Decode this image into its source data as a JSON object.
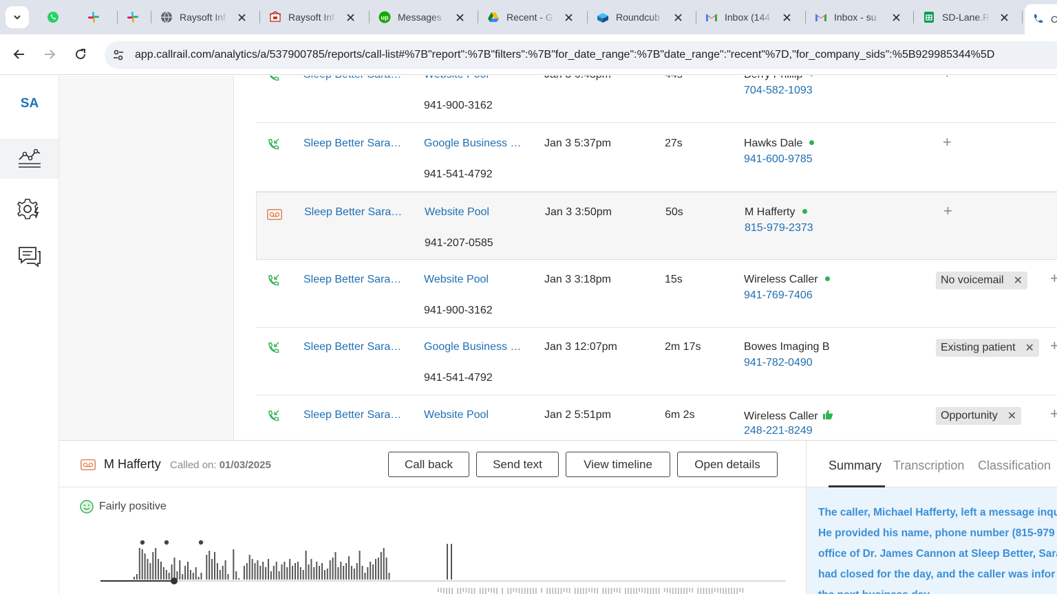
{
  "browser": {
    "tabs": [
      {
        "label": "",
        "icon": "whatsapp-icon"
      },
      {
        "label": "",
        "icon": "slack-icon"
      },
      {
        "label": "",
        "icon": "slack-icon"
      },
      {
        "label": "Raysoft Inf",
        "icon": "globe-icon"
      },
      {
        "label": "Raysoft Inf",
        "icon": "raysoft-icon"
      },
      {
        "label": "Messages",
        "icon": "upwork-icon"
      },
      {
        "label": "Recent - G",
        "icon": "google-drive-icon"
      },
      {
        "label": "Roundcub",
        "icon": "roundcube-icon"
      },
      {
        "label": "Inbox (144",
        "icon": "gmail-icon"
      },
      {
        "label": "Inbox - su",
        "icon": "gmail-icon"
      },
      {
        "label": "SD-Lane.R",
        "icon": "google-sheets-icon"
      },
      {
        "label": "C",
        "icon": "callrail-icon"
      }
    ],
    "url": "app.callrail.com/analytics/a/537900785/reports/call-list#%7B\"report\":%7B\"filters\":%7B\"for_date_range\":%7B\"date_range\":\"recent\"%7D,\"for_company_sids\":%5B929985344%5D"
  },
  "rail": {
    "logo": "SA"
  },
  "calls": [
    {
      "company": "Sleep Better Sara…",
      "source": "Website Pool",
      "tracking": "941-900-3162",
      "datetime": "Jan 3 6:43pm",
      "duration": "44s",
      "caller": "Berry Phillip",
      "caller_phone": "704-582-1093",
      "status": "dot",
      "tag": "",
      "type": "inbound"
    },
    {
      "company": "Sleep Better Sara…",
      "source": "Google Business …",
      "tracking": "941-541-4792",
      "datetime": "Jan 3 5:37pm",
      "duration": "27s",
      "caller": "Hawks Dale",
      "caller_phone": "941-600-9785",
      "status": "dot",
      "tag": "",
      "type": "inbound"
    },
    {
      "company": "Sleep Better Sara…",
      "source": "Website Pool",
      "tracking": "941-207-0585",
      "datetime": "Jan 3 3:50pm",
      "duration": "50s",
      "caller": "M Hafferty",
      "caller_phone": "815-979-2373",
      "status": "dot",
      "tag": "",
      "type": "voicemail"
    },
    {
      "company": "Sleep Better Sara…",
      "source": "Website Pool",
      "tracking": "941-900-3162",
      "datetime": "Jan 3 3:18pm",
      "duration": "15s",
      "caller": "Wireless Caller",
      "caller_phone": "941-769-7406",
      "status": "dot",
      "tag": "No voicemail",
      "type": "inbound"
    },
    {
      "company": "Sleep Better Sara…",
      "source": "Google Business …",
      "tracking": "941-541-4792",
      "datetime": "Jan 3 12:07pm",
      "duration": "2m 17s",
      "caller": "Bowes Imaging B",
      "caller_phone": "941-782-0490",
      "status": "",
      "tag": "Existing patient",
      "type": "inbound"
    },
    {
      "company": "Sleep Better Sara…",
      "source": "Website Pool",
      "tracking": "",
      "datetime": "Jan 2 5:51pm",
      "duration": "6m 2s",
      "caller": "Wireless Caller",
      "caller_phone": "248-221-8249",
      "status": "thumb",
      "tag": "Opportunity",
      "type": "inbound"
    }
  ],
  "detail": {
    "caller_name": "M Hafferty",
    "called_on_label": "Called on:",
    "called_on_date": "01/03/2025",
    "buttons": {
      "call_back": "Call back",
      "send_text": "Send text",
      "view_timeline": "View timeline",
      "open_details": "Open details"
    },
    "sentiment": "Fairly positive",
    "side_tabs": {
      "summary": "Summary",
      "transcription": "Transcription",
      "classification": "Classification"
    },
    "summary_lines": [
      "The caller, Michael Hafferty, left a message inqu",
      "He provided his name, phone number (815-979",
      "office of Dr. James Cannon at Sleep Better, Sara",
      "had closed for the day, and the caller was infor",
      "the next business day."
    ]
  },
  "colors": {
    "link": "#1f6fb2",
    "status_green": "#2eb34d",
    "voicemail_orange": "#e0784a",
    "summary_text": "#3b8fd6"
  }
}
